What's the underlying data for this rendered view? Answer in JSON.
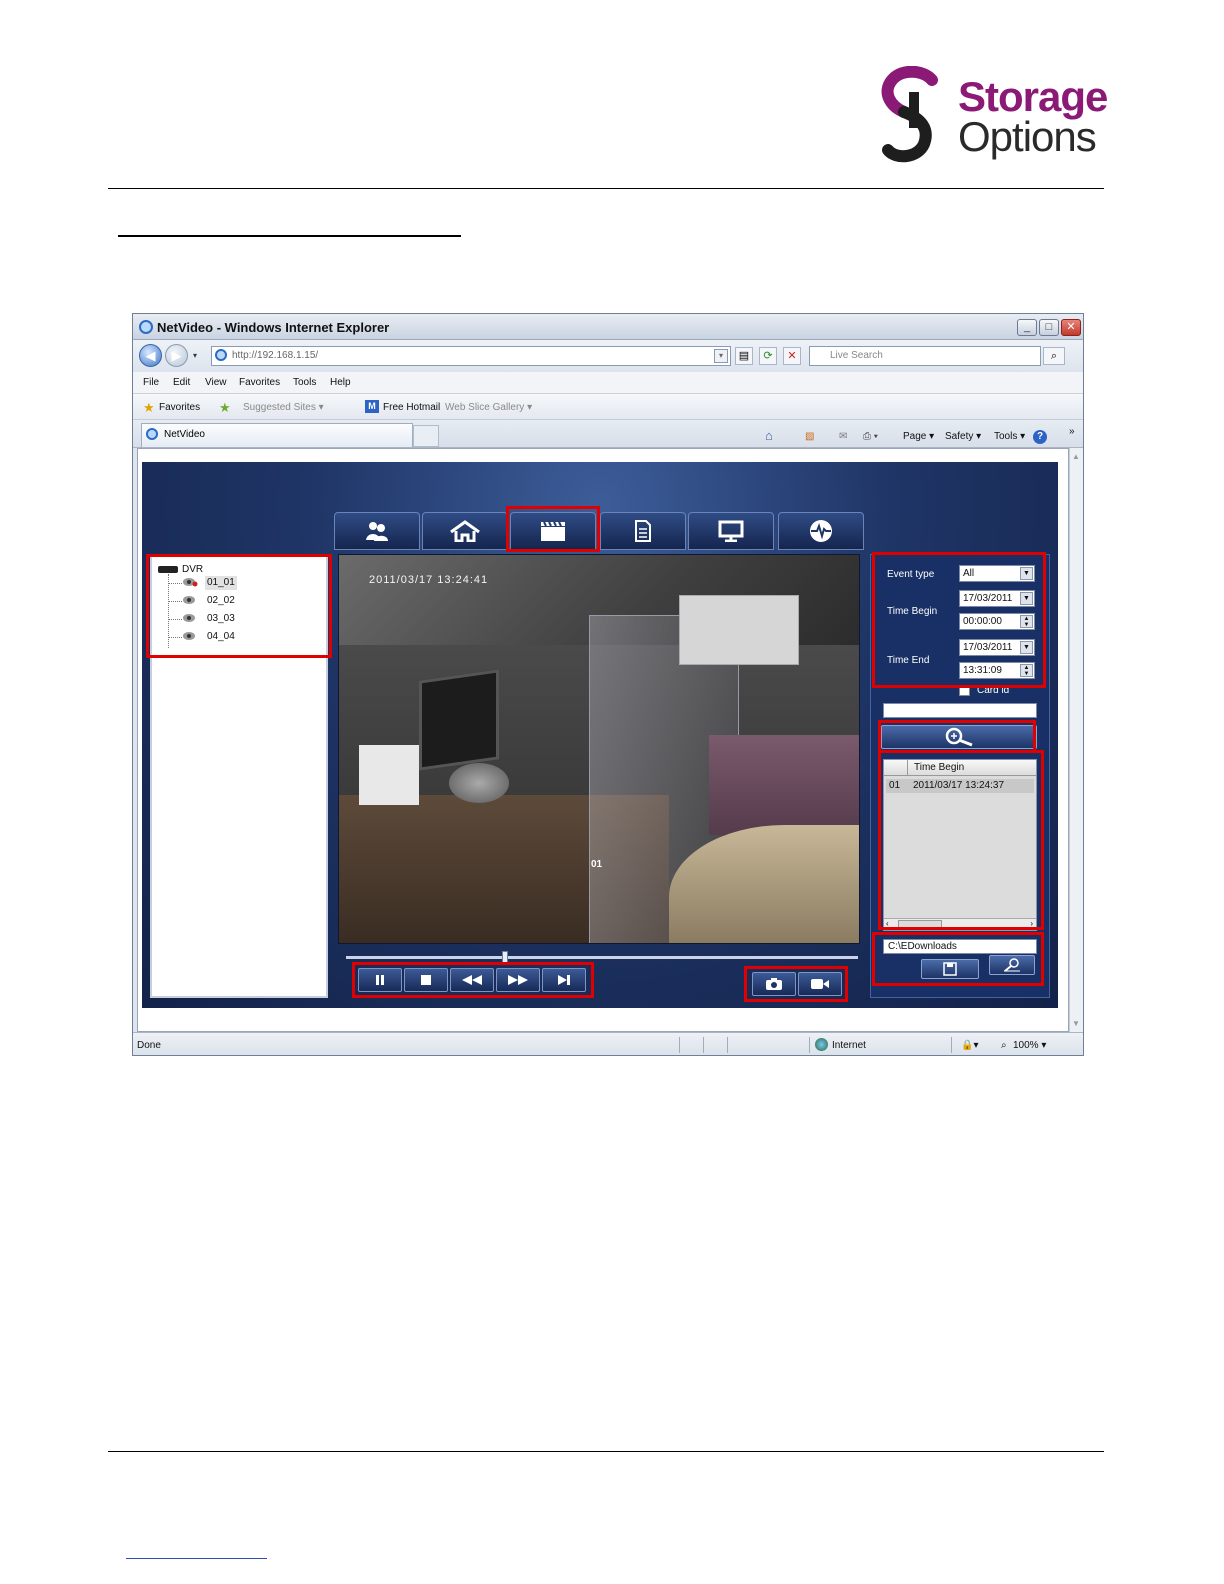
{
  "logo": {
    "line1": "Storage",
    "line2": "Options",
    "primary_color": "#8b1a77",
    "secondary_color": "#2a2a2a"
  },
  "browser": {
    "title": "NetVideo - Windows Internet Explorer",
    "address": "http://192.168.1.15/",
    "search_placeholder": "Live Search",
    "menu": [
      "File",
      "Edit",
      "View",
      "Favorites",
      "Tools",
      "Help"
    ],
    "favorites": {
      "label": "Favorites",
      "suggested": "Suggested Sites",
      "hotmail": "Free Hotmail",
      "gallery": "Web Slice Gallery"
    },
    "tab_title": "NetVideo",
    "commands": {
      "page": "Page",
      "safety": "Safety",
      "tools": "Tools"
    },
    "status": {
      "left": "Done",
      "zone": "Internet",
      "zoom": "100%"
    },
    "icons": [
      "back-icon",
      "forward-icon",
      "refresh-icon",
      "stop-icon",
      "search-icon",
      "home-icon",
      "feeds-icon",
      "mail-icon",
      "print-icon",
      "help-icon"
    ]
  },
  "app": {
    "nav_tabs": [
      "users-icon",
      "home-icon",
      "playback-icon",
      "document-icon",
      "monitor-icon",
      "health-icon"
    ],
    "active_tab": 2,
    "tree": {
      "root": "DVR",
      "channels": [
        "01_01",
        "02_02",
        "03_03",
        "04_04"
      ],
      "selected": 0
    },
    "video": {
      "timestamp": "2011/03/17 13:24:41",
      "channel": "01",
      "progress": 0.31
    },
    "controls": [
      "pause-icon",
      "stop-icon",
      "rewind-icon",
      "fast-forward-icon",
      "step-forward-icon"
    ],
    "capture": [
      "snapshot-icon",
      "record-icon"
    ],
    "search": {
      "event_type_label": "Event type",
      "event_type_value": "All",
      "time_begin_label": "Time Begin",
      "begin_date": "17/03/2011",
      "begin_time": "00:00:00",
      "time_end_label": "Time End",
      "end_date": "17/03/2011",
      "end_time": "13:31:09",
      "card_id_label": "Card id"
    },
    "results": {
      "column": "Time Begin",
      "rows": [
        {
          "index": "01",
          "time": "2011/03/17 13:24:37"
        }
      ]
    },
    "download_path": "C:\\EDownloads"
  },
  "highlight_color": "#e10000"
}
